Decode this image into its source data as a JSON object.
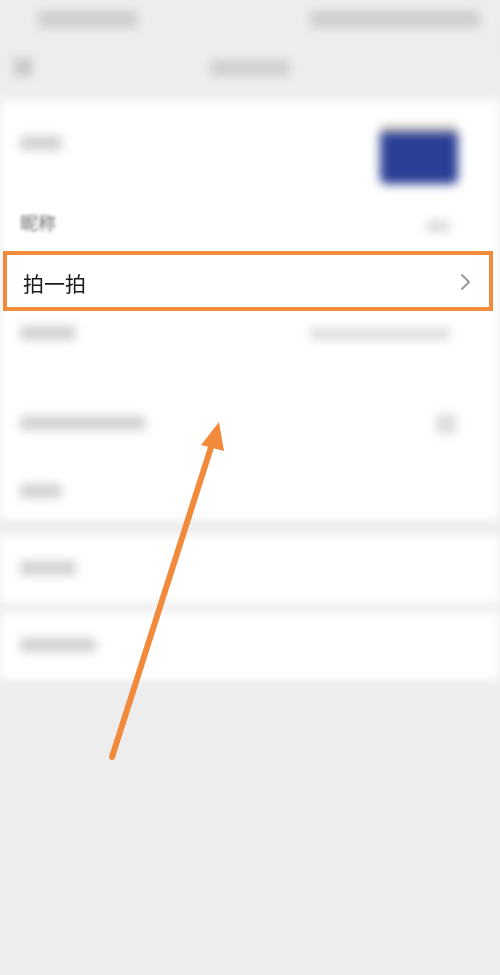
{
  "profile": {
    "nickname_label": "昵称",
    "pat_label": "拍一拍"
  },
  "annotation": {
    "highlight_color": "#f28a3b"
  }
}
